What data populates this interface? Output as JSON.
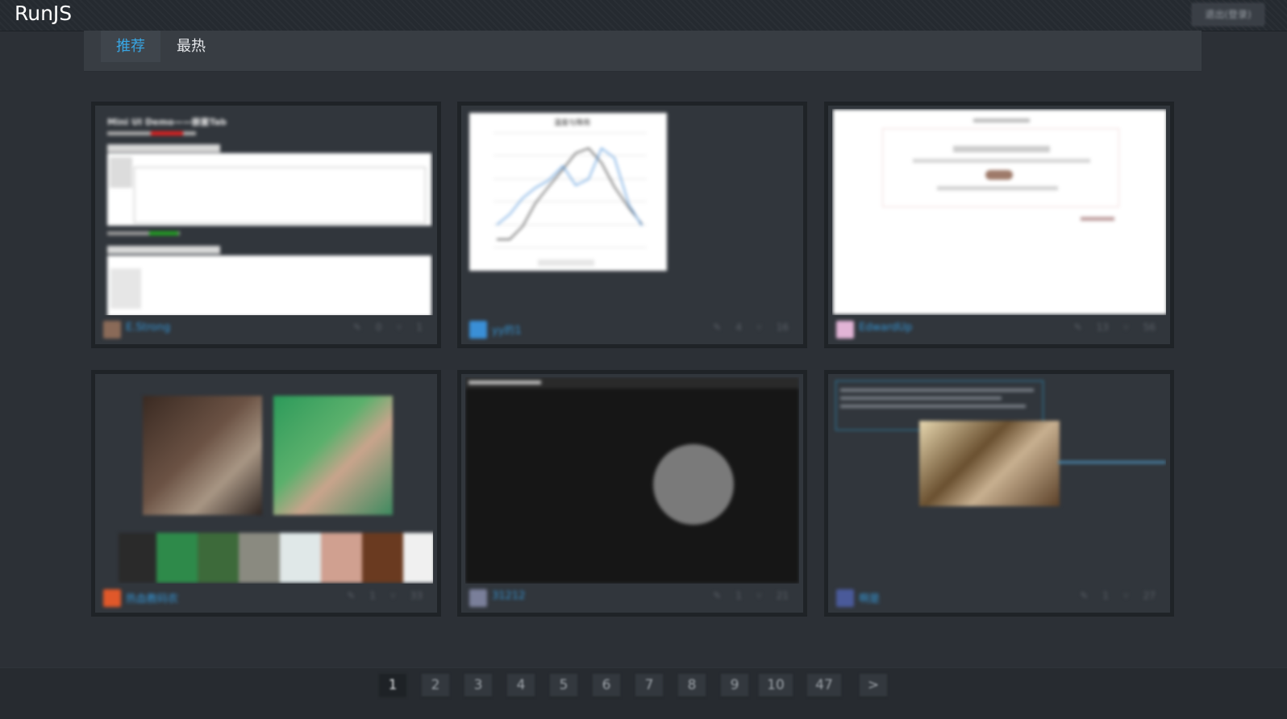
{
  "header": {
    "logo": "RunJS",
    "exit_label": "退出(登录)"
  },
  "tabs": [
    {
      "label": "推荐",
      "active": true
    },
    {
      "label": "最热",
      "active": false
    }
  ],
  "cards": [
    {
      "title": "Mini UI Demo——嵌套Tab",
      "author": "E.Strong",
      "comments": "0",
      "forks": "1"
    },
    {
      "title": "温度与降雨",
      "author": "yy的1",
      "comments": "4",
      "forks": "16"
    },
    {
      "title": "",
      "author": "EdwardUp",
      "comments": "13",
      "forks": "56"
    },
    {
      "title": "",
      "author": "热血教码农",
      "comments": "1",
      "forks": "33"
    },
    {
      "title": "",
      "author": "31212",
      "comments": "1",
      "forks": "21"
    },
    {
      "title": "",
      "author": "啊是",
      "comments": "1",
      "forks": "27"
    }
  ],
  "pagination": {
    "pages": [
      "1",
      "2",
      "3",
      "4",
      "5",
      "6",
      "7",
      "8",
      "9",
      "10",
      "47"
    ],
    "current": "1",
    "next_label": ">"
  },
  "colors": {
    "accent": "#38a6e4",
    "background": "#2c3036",
    "author_link": "#3596d6"
  }
}
